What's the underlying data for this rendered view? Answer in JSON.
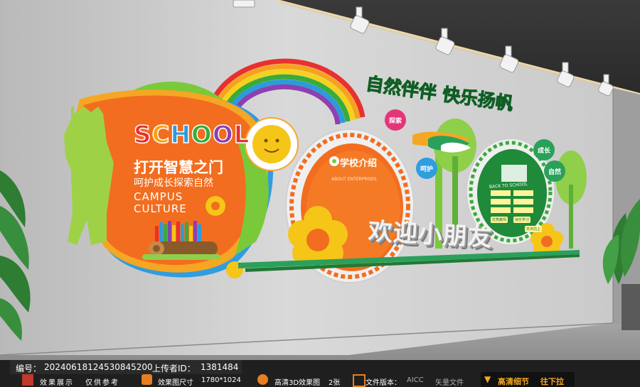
{
  "wall": {
    "school_word": "SCHOOL",
    "school_letter_colors": [
      "#e8312f",
      "#f7a21b",
      "#2c9bdb",
      "#3aab3a",
      "#8e3fb0",
      "#e8312f"
    ],
    "slogan_1": "打开智慧之门",
    "slogan_2": "呵护成长探索自然",
    "campus_line_1": "CAMPUS",
    "campus_line_2": "CULTURE",
    "intro_title": "学校介绍",
    "intro_subtitle": "ABOUT ENTERPRISES",
    "nature_slogan": "自然伴伴  快乐扬帆",
    "welcome_sign": "欢迎小朋友",
    "bubbles": [
      "探索",
      "呵护",
      "成长",
      "自然"
    ],
    "back_to_school": "BACK TO SCHOOL",
    "board_items": [
      "优秀教师",
      "快乐学习",
      "天天向上"
    ],
    "colors": {
      "orange": "#f26d1f",
      "green": "#7ac93a",
      "dark_green": "#1f9a3e",
      "yellow": "#f5c518"
    }
  },
  "footer": {
    "id_label": "编号：",
    "id_value": "20240618124530845200",
    "uploader_label": "上传者ID：",
    "uploader_value": "1381484",
    "tag_display": "效果展示",
    "tag_reference": "仅供参考",
    "size_label": "效果图尺寸",
    "size_value": "1780*1024",
    "hd_label": "高清3D效果图",
    "hd_count": "2张",
    "version_label": "文件版本：",
    "version_value": "AICC",
    "vector_label": "矢量文件",
    "hd_detail": "高清细节",
    "scroll_hint": "往下拉"
  }
}
